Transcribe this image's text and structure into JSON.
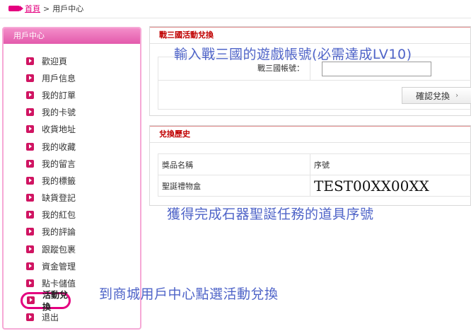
{
  "breadcrumb": {
    "home": "首頁",
    "separator": ">",
    "current": "用戶中心"
  },
  "sidebar": {
    "title": "用戶中心",
    "items": [
      {
        "label": "歡迎頁"
      },
      {
        "label": "用戶信息"
      },
      {
        "label": "我的訂單"
      },
      {
        "label": "我的卡號"
      },
      {
        "label": "收貨地址"
      },
      {
        "label": "我的收藏"
      },
      {
        "label": "我的留言"
      },
      {
        "label": "我的標籤"
      },
      {
        "label": "缺貨登記"
      },
      {
        "label": "我的紅包"
      },
      {
        "label": "我的評論"
      },
      {
        "label": "跟蹤包裹"
      },
      {
        "label": "資金管理"
      },
      {
        "label": "點卡儲值"
      },
      {
        "label": "活動兌換",
        "active": true
      },
      {
        "label": "退出"
      }
    ]
  },
  "exchange": {
    "title": "戰三國活動兌換",
    "field_label": "戰三國帳號：",
    "field_value": "",
    "confirm_label": "確認兌換"
  },
  "history": {
    "title": "兌換歷史",
    "headers": [
      "獎品名稱",
      "序號"
    ],
    "rows": [
      [
        "聖誕禮物盒",
        "TEST00XX00XX"
      ]
    ]
  },
  "annotations": {
    "account_hint": "輸入戰三國的遊戲帳號(必需達成LV10)",
    "serial_hint": "獲得完成石器聖誕任務的道具序號",
    "menu_hint": "到商城用戶中心點選活動兌換"
  },
  "colors": {
    "accent": "#e4007f",
    "title_red": "#c00000",
    "annotation_blue": "#4f64c8",
    "sidebar_border": "#f6a9d6"
  }
}
